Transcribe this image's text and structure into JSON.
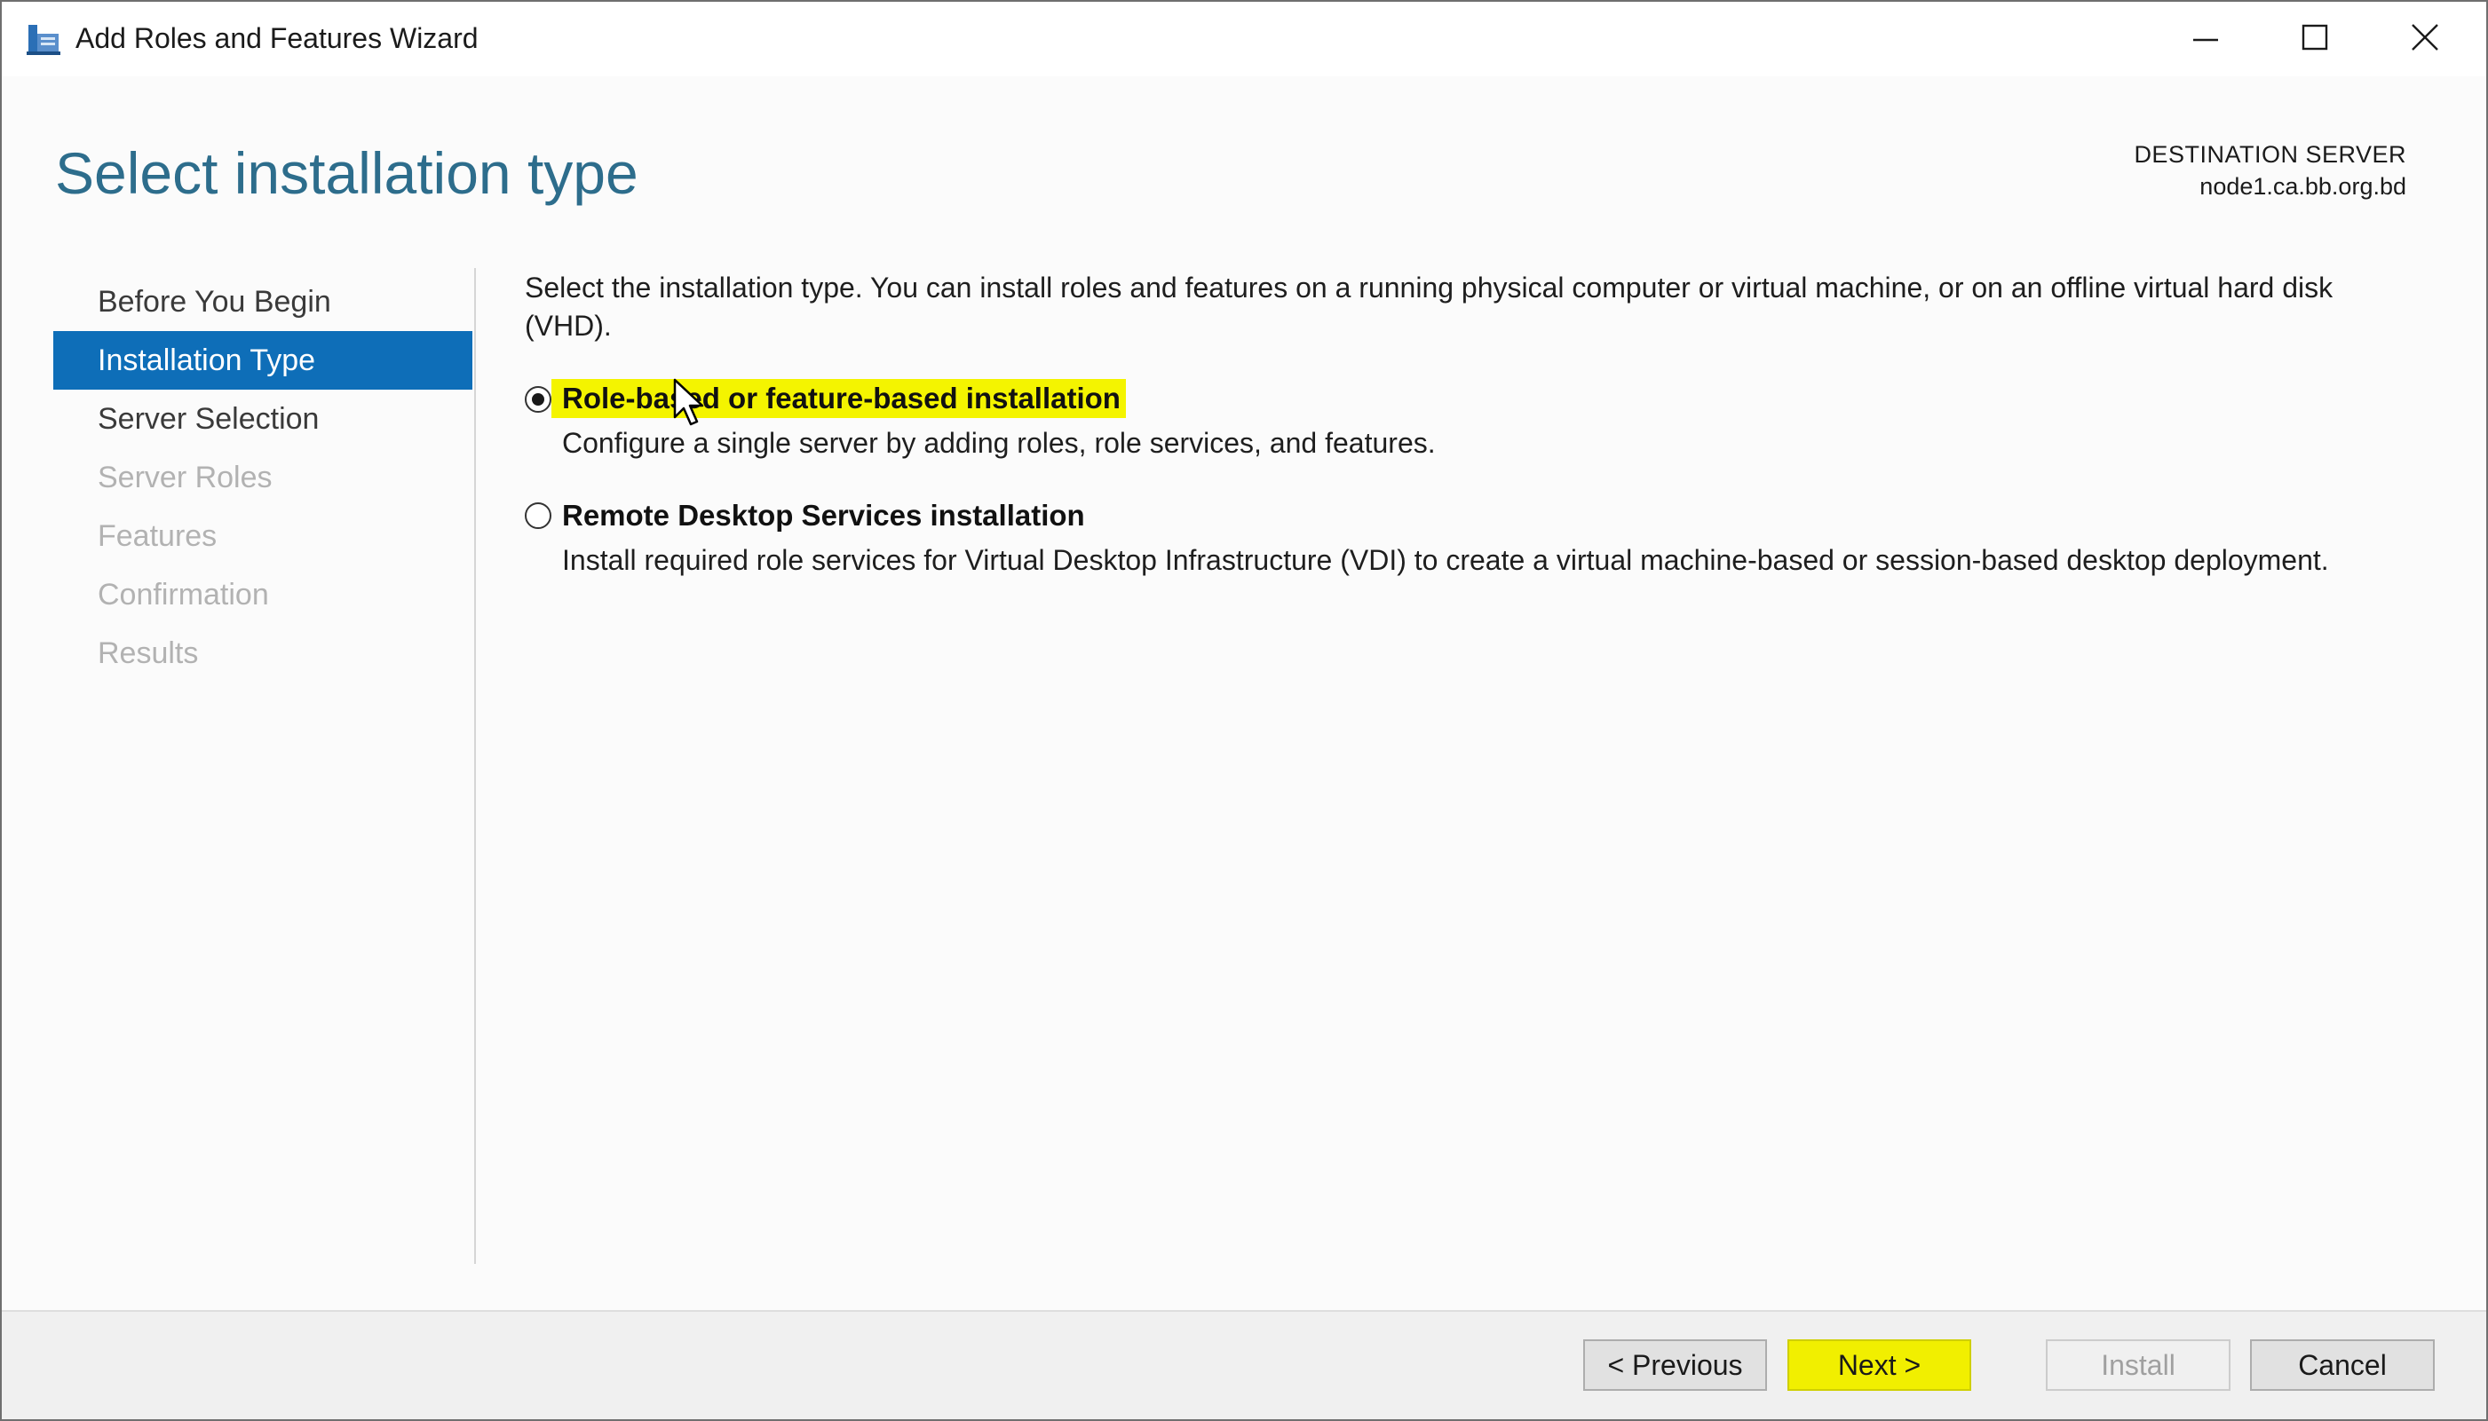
{
  "window": {
    "title": "Add Roles and Features Wizard"
  },
  "header": {
    "page_title": "Select installation type",
    "destination_label": "DESTINATION SERVER",
    "destination_server": "node1.ca.bb.org.bd"
  },
  "nav": {
    "items": [
      {
        "label": "Before You Begin",
        "state": "normal"
      },
      {
        "label": "Installation Type",
        "state": "active"
      },
      {
        "label": "Server Selection",
        "state": "normal"
      },
      {
        "label": "Server Roles",
        "state": "disabled"
      },
      {
        "label": "Features",
        "state": "disabled"
      },
      {
        "label": "Confirmation",
        "state": "disabled"
      },
      {
        "label": "Results",
        "state": "disabled"
      }
    ]
  },
  "content": {
    "intro_line1": "Select the installation type. You can install roles and features on a running physical computer or virtual machine, or on an offline virtual hard disk",
    "intro_line2": "(VHD).",
    "options": [
      {
        "label": "Role-based or feature-based installation",
        "description": "Configure a single server by adding roles, role services, and features.",
        "selected": true
      },
      {
        "label": "Remote Desktop Services installation",
        "description": "Install required role services for Virtual Desktop Infrastructure (VDI) to create a virtual machine-based or session-based desktop deployment.",
        "selected": false
      }
    ]
  },
  "footer": {
    "previous_label": "< Previous",
    "next_label": "Next >",
    "install_label": "Install",
    "cancel_label": "Cancel"
  },
  "colors": {
    "accent_nav": "#0e6eb8",
    "title": "#2d6d8c",
    "highlight": "#f4f400"
  },
  "icons": [
    "server-manager-icon",
    "minimize-icon",
    "maximize-icon",
    "close-icon",
    "mouse-cursor-icon"
  ]
}
